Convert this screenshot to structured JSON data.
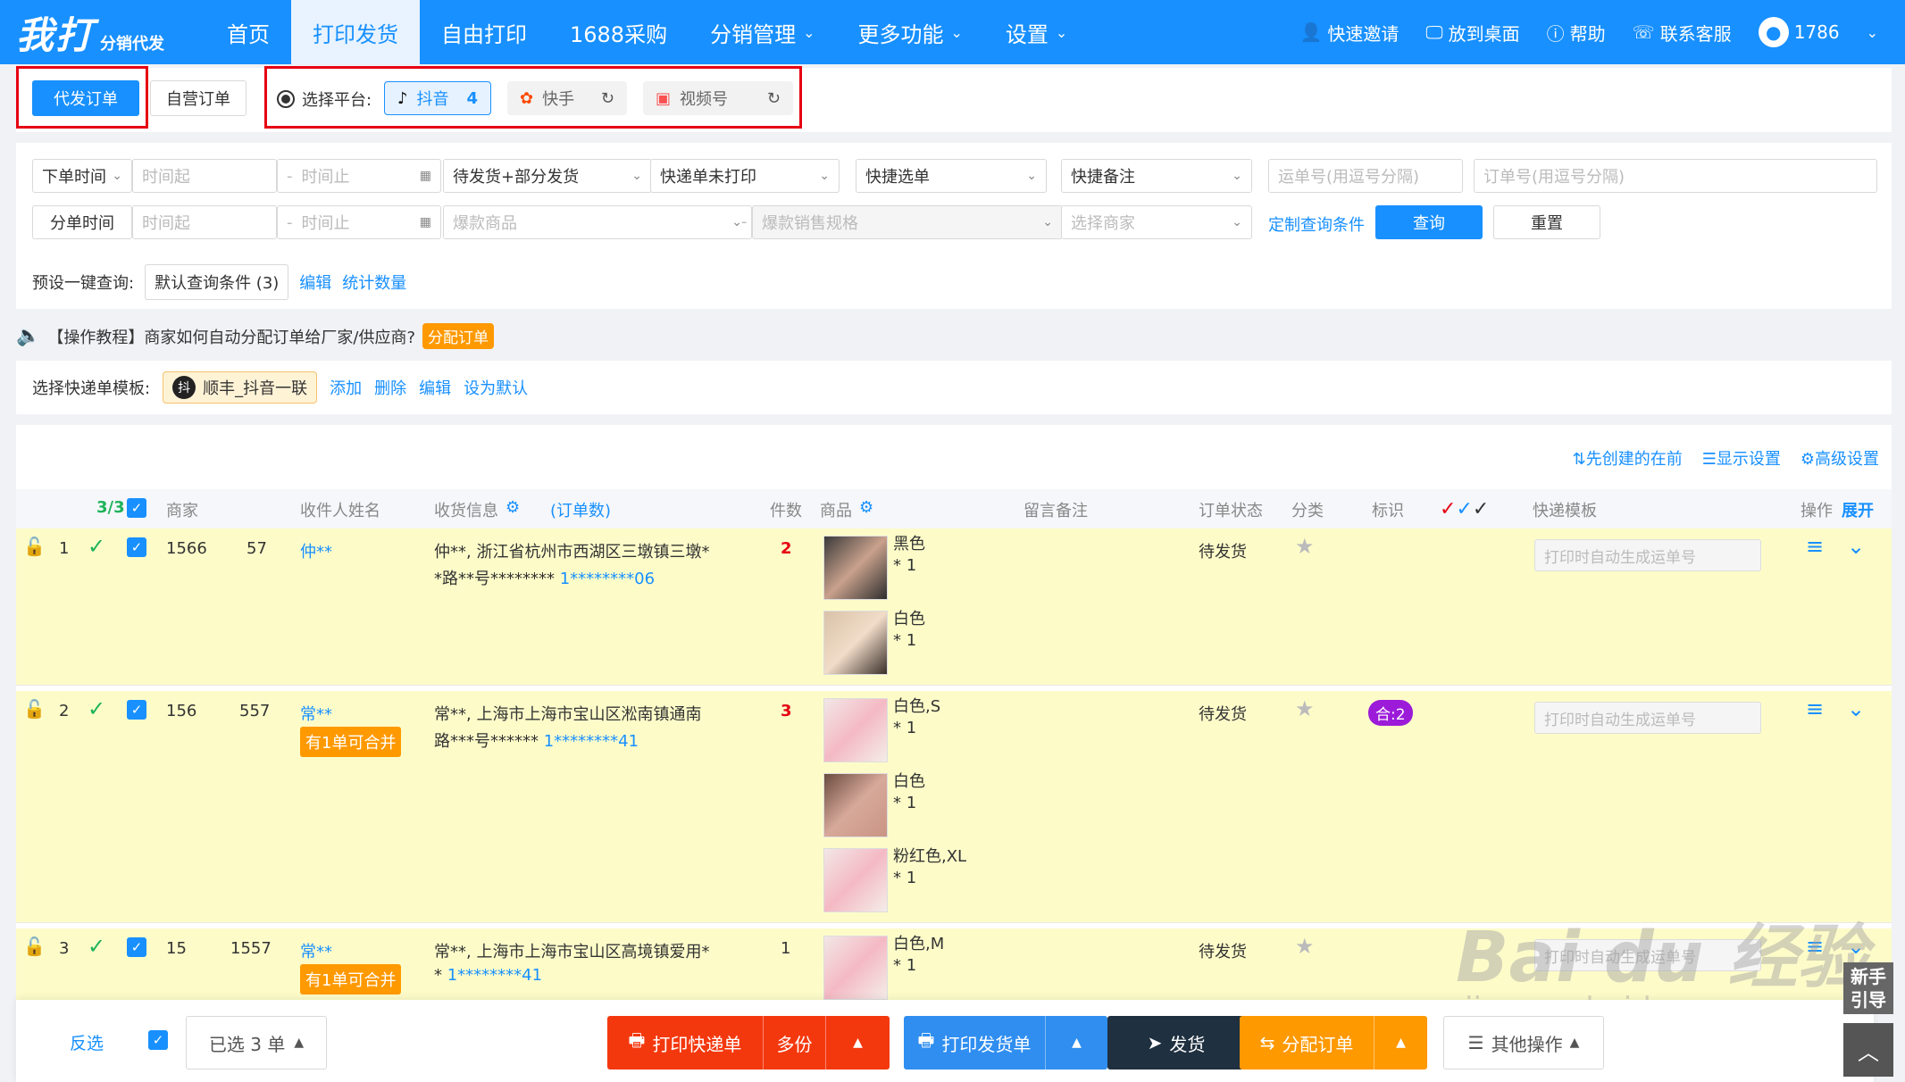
{
  "nav": {
    "logo_main": "我打",
    "logo_sub": "分销代发",
    "items": [
      "首页",
      "打印发货",
      "自由打印",
      "1688采购",
      "分销管理",
      "更多功能",
      "设置"
    ],
    "right": [
      "快速邀请",
      "放到桌面",
      "帮助",
      "联系客服",
      "1786"
    ]
  },
  "platform": {
    "tab_agent": "代发订单",
    "tab_self": "自营订单",
    "select_label": "选择平台:",
    "douyin": "抖音",
    "douyin_count": "4",
    "kuaishou": "快手",
    "shipinhao": "视频号"
  },
  "filters": {
    "order_time": "下单时间",
    "time_start": "时间起",
    "time_end": "时间止",
    "status": "待发货+部分发货",
    "print_status": "快递单未打印",
    "quick_select": "快捷选单",
    "quick_note": "快捷备注",
    "waybill_ph": "运单号(用逗号分隔)",
    "order_ph": "订单号(用逗号分隔)",
    "split_time": "分单时间",
    "hot_goods": "爆款商品",
    "hot_spec": "爆款销售规格",
    "merchant": "选择商家",
    "custom_query": "定制查询条件",
    "query": "查询",
    "reset": "重置"
  },
  "preset": {
    "label": "预设一键查询:",
    "default": "默认查询条件 (3)",
    "edit": "编辑",
    "count": "统计数量"
  },
  "notice": {
    "text": "【操作教程】商家如何自动分配订单给厂家/供应商?",
    "tag": "分配订单"
  },
  "template": {
    "label": "选择快递单模板:",
    "chip_icon": "抖",
    "chip": "顺丰_抖音一联",
    "add": "添加",
    "delete": "删除",
    "edit": "编辑",
    "set_default": "设为默认"
  },
  "table": {
    "tools": [
      "先创建的在前",
      "显示设置",
      "高级设置"
    ],
    "headers": {
      "count": "3/3",
      "merchant": "商家",
      "receiver": "收件人姓名",
      "address": "收货信息",
      "order_count": "(订单数)",
      "qty": "件数",
      "goods": "商品",
      "memo": "留言备注",
      "status": "订单状态",
      "category": "分类",
      "mark": "标识",
      "tpl": "快递模板",
      "op": "操作",
      "expand": "展开"
    },
    "waybill_ph": "打印时自动生成运单号",
    "rows": [
      {
        "idx": "1",
        "merchant_a": "1566",
        "merchant_b": "57",
        "name": "仲**",
        "addr1": "仲**, 浙江省杭州市西湖区三墩镇三墩*",
        "addr2": "*路**号********",
        "phone": "1********06",
        "qty": "2",
        "goods": [
          {
            "attr": "黑色",
            "n": "* 1"
          },
          {
            "attr": "白色",
            "n": "* 1"
          }
        ],
        "status": "待发货"
      },
      {
        "idx": "2",
        "merchant_a": "156",
        "merchant_b": "557",
        "name": "常**",
        "merge": "有1单可合并",
        "addr1": "常**, 上海市上海市宝山区淞南镇通南",
        "addr2": "路***号******",
        "phone": "1********41",
        "qty": "3",
        "goods": [
          {
            "attr": "白色,S",
            "n": "* 1"
          },
          {
            "attr": "白色",
            "n": "* 1"
          },
          {
            "attr": "粉红色,XL",
            "n": "* 1"
          }
        ],
        "status": "待发货",
        "tag": "合:2"
      },
      {
        "idx": "3",
        "merchant_a": "15",
        "merchant_b": "1557",
        "name": "常**",
        "merge": "有1单可合并",
        "addr1": "常**, 上海市上海市宝山区高境镇爱用*",
        "addr2": "*",
        "phone": "1********41",
        "qty": "1",
        "goods": [
          {
            "attr": "白色,M",
            "n": "* 1"
          }
        ],
        "status": "待发货"
      }
    ]
  },
  "bottom": {
    "invert": "反选",
    "selected": "已选 3 单",
    "print_waybill": "打印快递单",
    "multi": "多份",
    "print_ship": "打印发货单",
    "ship": "发货",
    "assign": "分配订单",
    "other": "其他操作"
  },
  "side": {
    "newbie": "新手引导"
  },
  "watermark": {
    "main": "Bai du 经验",
    "sub": "jingyan.baidu.com"
  },
  "colors": {
    "primary": "#1890ff",
    "row_bg": "#fdfcc9",
    "print_red": "#f4380e",
    "ship_dark": "#1f3040",
    "assign_orange": "#ff9900"
  }
}
